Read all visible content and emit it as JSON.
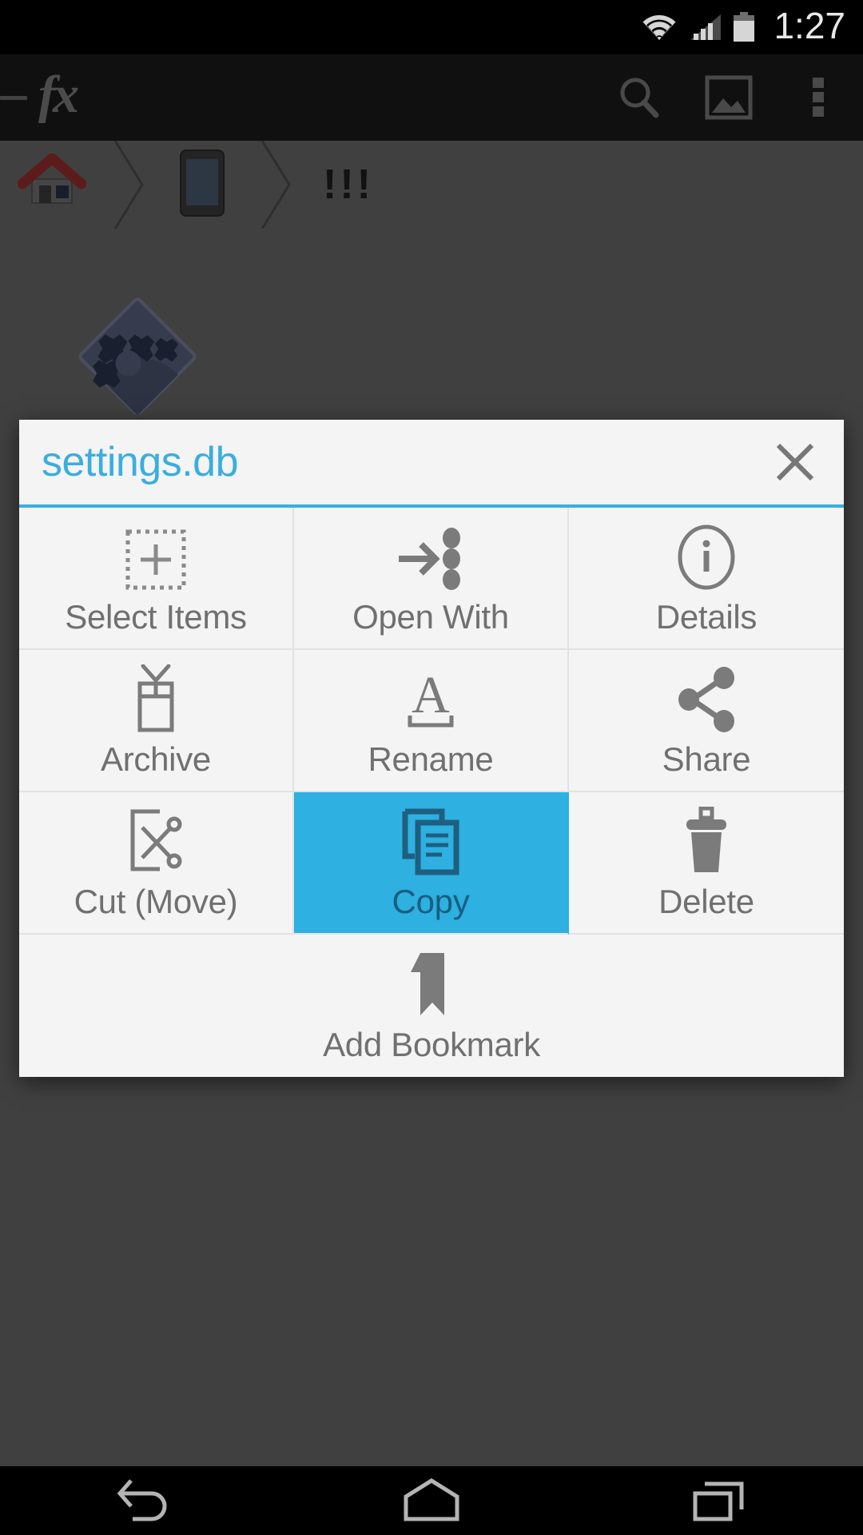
{
  "status_bar": {
    "time": "1:27",
    "icons": [
      "wifi-icon",
      "cellular-signal-icon",
      "battery-icon"
    ]
  },
  "app_bar": {
    "logo_text": "fx",
    "drawer_icon": "drawer-handle-icon",
    "actions": [
      {
        "name": "search-icon",
        "label": "Search"
      },
      {
        "name": "gallery-icon",
        "label": "Gallery"
      },
      {
        "name": "overflow-menu-icon",
        "label": "More options"
      }
    ]
  },
  "breadcrumb": {
    "items": [
      {
        "name": "home-crumb",
        "icon": "home-icon",
        "label": ""
      },
      {
        "name": "device-crumb",
        "icon": "phone-icon",
        "label": ""
      },
      {
        "name": "folder-crumb",
        "icon": "",
        "label": "!!!"
      }
    ],
    "separator": "chevron-right-icon"
  },
  "file_area": {
    "files": [
      {
        "name": "settings-db-file",
        "icon": "database-gear-icon",
        "label": ""
      }
    ]
  },
  "dialog": {
    "title": "settings.db",
    "title_color": "#3aaede",
    "close_icon": "close-icon",
    "accent_color": "#3aaede",
    "selected_color": "#2eb0e0",
    "selected_text_color": "#175f80",
    "rows": [
      [
        {
          "label": "Select Items",
          "icon": "select-items-icon",
          "selected": false
        },
        {
          "label": "Open With",
          "icon": "open-with-icon",
          "selected": false
        },
        {
          "label": "Details",
          "icon": "info-icon",
          "selected": false
        }
      ],
      [
        {
          "label": "Archive",
          "icon": "archive-icon",
          "selected": false
        },
        {
          "label": "Rename",
          "icon": "rename-icon",
          "selected": false
        },
        {
          "label": "Share",
          "icon": "share-icon",
          "selected": false
        }
      ],
      [
        {
          "label": "Cut (Move)",
          "icon": "cut-icon",
          "selected": false
        },
        {
          "label": "Copy",
          "icon": "copy-icon",
          "selected": true
        },
        {
          "label": "Delete",
          "icon": "trash-icon",
          "selected": false
        }
      ]
    ],
    "footer": {
      "label": "Add Bookmark",
      "icon": "bookmark-icon"
    }
  },
  "nav_bar": {
    "buttons": [
      {
        "name": "back-button",
        "icon": "back-arrow-icon"
      },
      {
        "name": "home-button",
        "icon": "home-pentagon-icon"
      },
      {
        "name": "recents-button",
        "icon": "recents-icon"
      }
    ]
  }
}
